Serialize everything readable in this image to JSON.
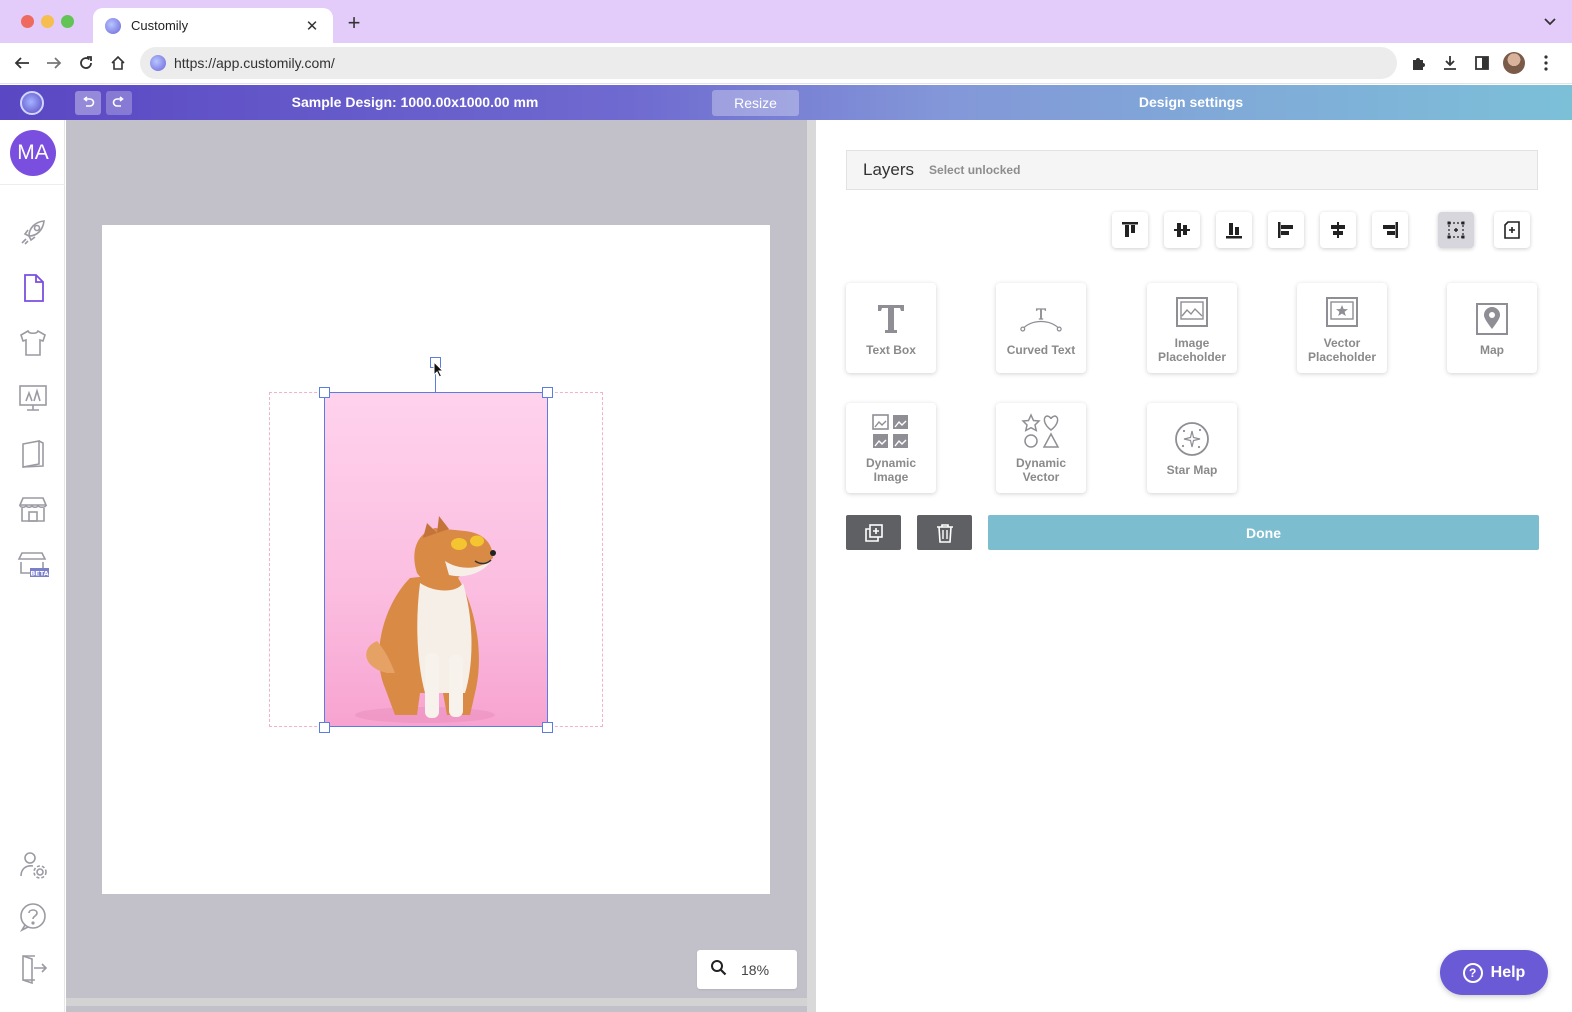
{
  "browser": {
    "tab_title": "Customily",
    "tab_close": "✕",
    "new_tab": "+",
    "tab_menu": "⌄",
    "url": "https://app.customily.com/"
  },
  "header": {
    "design_title": "Sample Design: 1000.00x1000.00 mm",
    "resize_label": "Resize",
    "settings_title": "Design settings"
  },
  "sidebar": {
    "avatar_initials": "MA",
    "items": [
      {
        "icon": "rocket-icon"
      },
      {
        "icon": "document-icon",
        "active": true
      },
      {
        "icon": "tshirt-icon"
      },
      {
        "icon": "presentation-icon"
      },
      {
        "icon": "book-icon"
      },
      {
        "icon": "store-icon"
      },
      {
        "icon": "store-beta-icon",
        "badge": "BETA"
      }
    ],
    "bottom_items": [
      {
        "icon": "user-settings-icon"
      },
      {
        "icon": "help-circle-icon"
      },
      {
        "icon": "logout-icon"
      }
    ]
  },
  "canvas": {
    "zoom": "18%"
  },
  "layers": {
    "title": "Layers",
    "subtitle": "Select unlocked"
  },
  "elements": [
    {
      "label": "Text Box",
      "icon": "text-box-icon"
    },
    {
      "label": "Curved Text",
      "icon": "curved-text-icon"
    },
    {
      "label": "Image Placeholder",
      "icon": "image-placeholder-icon"
    },
    {
      "label": "Vector Placeholder",
      "icon": "vector-placeholder-icon"
    },
    {
      "label": "Map",
      "icon": "map-pin-icon"
    },
    {
      "label": "Dynamic Image",
      "icon": "dynamic-image-icon"
    },
    {
      "label": "Dynamic Vector",
      "icon": "dynamic-vector-icon"
    },
    {
      "label": "Star Map",
      "icon": "star-map-icon"
    }
  ],
  "actions": {
    "done_label": "Done"
  },
  "help": {
    "label": "Help",
    "q": "?"
  },
  "colors": {
    "accent_purple": "#6b5ad5",
    "done_blue": "#7cbdd0",
    "selection_blue": "#5b7de3"
  }
}
